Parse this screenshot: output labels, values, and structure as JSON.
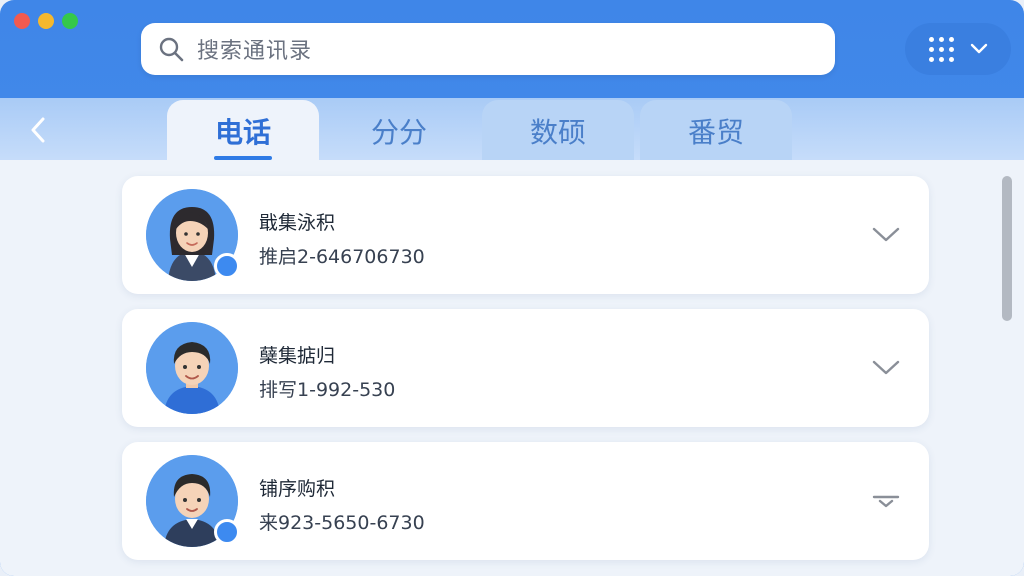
{
  "search": {
    "placeholder": "搜索通讯录",
    "icon": "search-icon"
  },
  "apps_button": {
    "icon": "grid-icon",
    "chevron": "chevron-down-icon"
  },
  "tabs": [
    {
      "label": "电话",
      "active": true
    },
    {
      "label": "分分",
      "active": false
    },
    {
      "label": "数硕",
      "active": false
    },
    {
      "label": "番贸",
      "active": false
    }
  ],
  "contacts": [
    {
      "name": "戢集泳积",
      "phone": "推启2-646706730",
      "online": true
    },
    {
      "name": "蘖集掂归",
      "phone": "排写1-992-530",
      "online": false
    },
    {
      "name": "铺序购积",
      "phone": "来923-5650-6730",
      "online": true
    }
  ],
  "colors": {
    "accent": "#2f7be6",
    "header": "#4a90ee",
    "status": "#3d8af0"
  }
}
